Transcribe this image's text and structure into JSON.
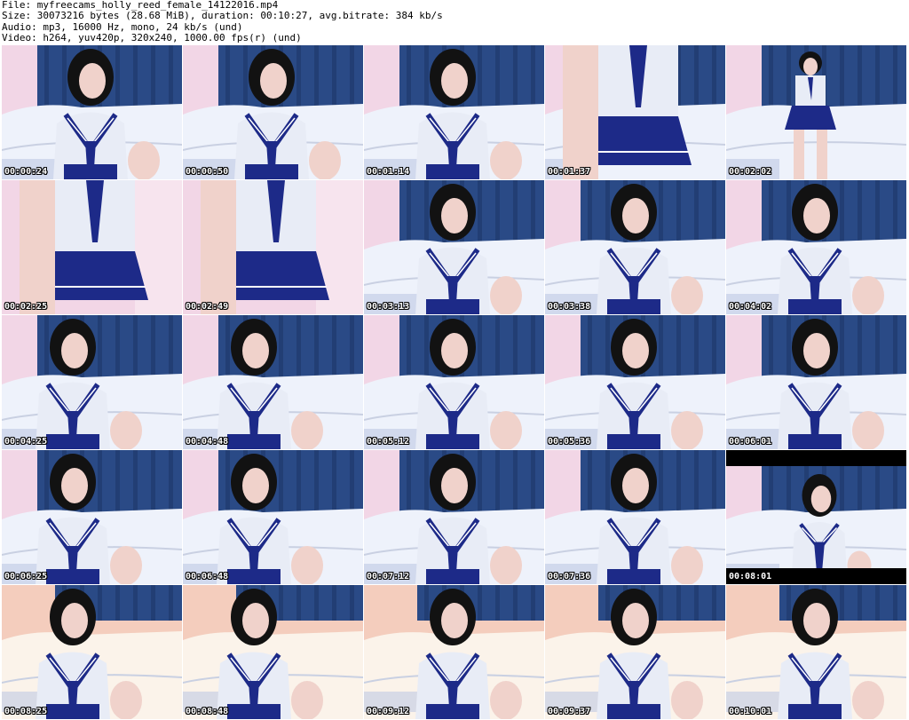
{
  "header": {
    "file": "File: myfreecams_holly_reed_female_14122016.mp4",
    "size": "Size: 30073216 bytes (28.68 MiB), duration: 00:10:27, avg.bitrate: 384 kb/s",
    "audio": "Audio: mp3, 16000 Hz, mono, 24 kb/s (und)",
    "video": "Video: h264, yuv420p, 320x240, 1000.00 fps(r) (und)"
  },
  "colors": {
    "curtain": "#2a4a86",
    "wall_pink": "#f2d6e6",
    "sofa_white": "#eef2fb",
    "hair": "#121212",
    "skin": "#f0d2cb",
    "top_white": "#e8ecf6",
    "navy": "#1d2a88",
    "warm_wall": "#f4cdbd",
    "warm_sofa": "#fbf3ea"
  },
  "thumbnails": [
    {
      "time": "00:00:24",
      "scene": "cool",
      "pose": "center"
    },
    {
      "time": "00:00:50",
      "scene": "cool",
      "pose": "center"
    },
    {
      "time": "00:01:14",
      "scene": "cool",
      "pose": "center"
    },
    {
      "time": "00:01:37",
      "scene": "cool",
      "pose": "torso"
    },
    {
      "time": "00:02:02",
      "scene": "cool",
      "pose": "standing"
    },
    {
      "time": "00:02:25",
      "scene": "pink",
      "pose": "torso"
    },
    {
      "time": "00:02:49",
      "scene": "pink",
      "pose": "torso"
    },
    {
      "time": "00:03:13",
      "scene": "cool",
      "pose": "center"
    },
    {
      "time": "00:03:38",
      "scene": "cool",
      "pose": "center"
    },
    {
      "time": "00:04:02",
      "scene": "cool",
      "pose": "center"
    },
    {
      "time": "00:04:25",
      "scene": "cool",
      "pose": "left"
    },
    {
      "time": "00:04:48",
      "scene": "cool",
      "pose": "left"
    },
    {
      "time": "00:05:12",
      "scene": "cool",
      "pose": "center"
    },
    {
      "time": "00:05:36",
      "scene": "cool",
      "pose": "center"
    },
    {
      "time": "00:06:01",
      "scene": "cool",
      "pose": "center"
    },
    {
      "time": "00:06:25",
      "scene": "cool",
      "pose": "left"
    },
    {
      "time": "00:06:48",
      "scene": "cool",
      "pose": "left"
    },
    {
      "time": "00:07:12",
      "scene": "cool",
      "pose": "center"
    },
    {
      "time": "00:07:36",
      "scene": "cool",
      "pose": "center"
    },
    {
      "time": "00:08:01",
      "scene": "cool_letterbox",
      "pose": "small"
    },
    {
      "time": "00:08:25",
      "scene": "warm",
      "pose": "left"
    },
    {
      "time": "00:08:48",
      "scene": "warm",
      "pose": "left"
    },
    {
      "time": "00:09:12",
      "scene": "warm",
      "pose": "center"
    },
    {
      "time": "00:09:37",
      "scene": "warm",
      "pose": "center"
    },
    {
      "time": "00:10:01",
      "scene": "warm",
      "pose": "center"
    }
  ]
}
